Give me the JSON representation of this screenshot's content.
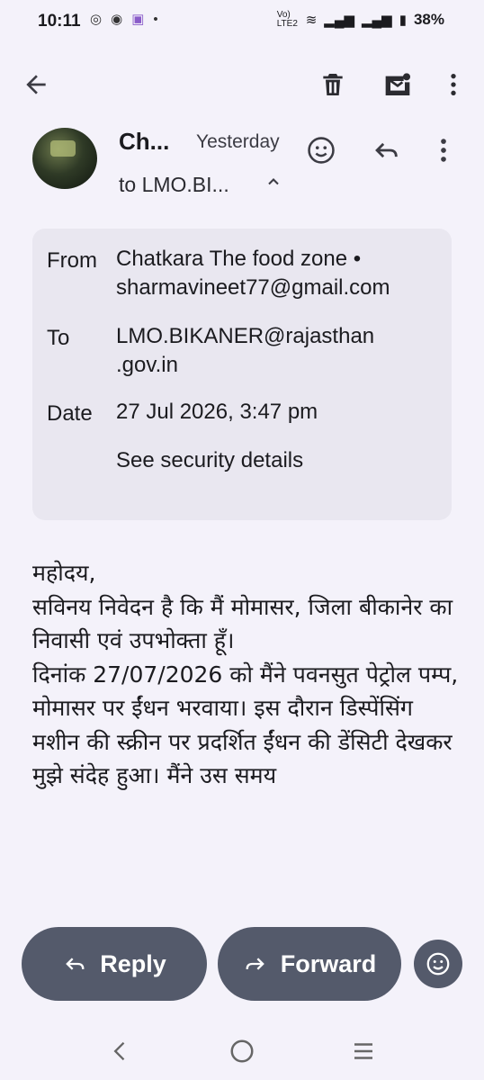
{
  "status": {
    "time": "10:11",
    "network_label": "Vo) LTE2",
    "battery": "38%"
  },
  "toolbar": {
    "back_icon": "arrow-back-icon",
    "delete_icon": "trash-icon",
    "mark_unread_icon": "mail-unread-icon",
    "more_icon": "more-vert-icon"
  },
  "message": {
    "sender_short": "Ch...",
    "when": "Yesterday",
    "to_short": "to LMO.BI..."
  },
  "details": {
    "from_label": "From",
    "from_value": "Chatkara The food zone • sharmavineet77@gmail.com",
    "to_label": "To",
    "to_value": "LMO.BIKANER@rajasthan .gov.in",
    "date_label": "Date",
    "date_value": "27 Jul 2026, 3:47 pm",
    "security_link": "See security details"
  },
  "body": {
    "line1": "महोदय,",
    "line2": "सविनय निवेदन है कि मैं मोमासर, जिला बीकानेर का निवासी एवं उपभोक्ता हूँ।",
    "line3": "दिनांक 27/07/2026 को मैंने पवनसुत पेट्रोल पम्प, मोमासर पर ईंधन भरवाया। इस दौरान डिस्पेंसिंग मशीन की स्क्रीन पर प्रदर्शित ईंधन की डेंसिटी देखकर मुझे संदेह हुआ। मैंने उस समय"
  },
  "actions": {
    "reply_label": "Reply",
    "forward_label": "Forward"
  }
}
